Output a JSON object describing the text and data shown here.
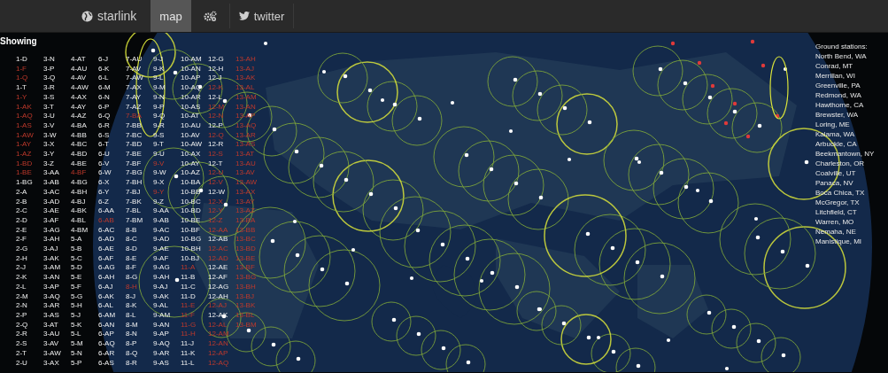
{
  "navbar": {
    "items": [
      {
        "kind": "brand",
        "label": "starlink",
        "selected": false
      },
      {
        "kind": "tab",
        "label": "map",
        "selected": true
      },
      {
        "kind": "settings",
        "selected": false
      },
      {
        "kind": "twitter",
        "label": "twitter",
        "selected": false
      }
    ]
  },
  "satellite_list": {
    "title": "Showing",
    "columns": [
      {
        "items": [
          {
            "label": "1-D",
            "active": true
          },
          {
            "label": "1-F",
            "active": false
          },
          {
            "label": "1-Q",
            "active": false
          },
          {
            "label": "1-T",
            "active": true
          },
          {
            "label": "1-Y",
            "active": false
          },
          {
            "label": "1-AK",
            "active": false
          },
          {
            "label": "1-AQ",
            "active": false
          },
          {
            "label": "1-AS",
            "active": false
          },
          {
            "label": "1-AW",
            "active": false
          },
          {
            "label": "1-AY",
            "active": false
          },
          {
            "label": "1-AZ",
            "active": false
          },
          {
            "label": "1-BD",
            "active": false
          },
          {
            "label": "1-BE",
            "active": false
          },
          {
            "label": "1-BG",
            "active": true
          },
          {
            "label": "2-A",
            "active": true
          },
          {
            "label": "2-B",
            "active": true
          },
          {
            "label": "2-C",
            "active": true
          },
          {
            "label": "2-D",
            "active": true
          },
          {
            "label": "2-E",
            "active": true
          },
          {
            "label": "2-F",
            "active": true
          },
          {
            "label": "2-G",
            "active": true
          },
          {
            "label": "2-H",
            "active": true
          },
          {
            "label": "2-J",
            "active": true
          },
          {
            "label": "2-K",
            "active": true
          },
          {
            "label": "2-L",
            "active": true
          },
          {
            "label": "2-M",
            "active": true
          },
          {
            "label": "2-N",
            "active": true
          },
          {
            "label": "2-P",
            "active": true
          },
          {
            "label": "2-Q",
            "active": true
          },
          {
            "label": "2-R",
            "active": true
          },
          {
            "label": "2-S",
            "active": true
          },
          {
            "label": "2-T",
            "active": true
          },
          {
            "label": "2-U",
            "active": true
          }
        ]
      },
      {
        "items": [
          {
            "label": "3-N",
            "active": true
          },
          {
            "label": "3-P",
            "active": true
          },
          {
            "label": "3-Q",
            "active": true
          },
          {
            "label": "3-R",
            "active": true
          },
          {
            "label": "3-S",
            "active": true
          },
          {
            "label": "3-T",
            "active": true
          },
          {
            "label": "3-U",
            "active": true
          },
          {
            "label": "3-V",
            "active": true
          },
          {
            "label": "3-W",
            "active": true
          },
          {
            "label": "3-X",
            "active": true
          },
          {
            "label": "3-Y",
            "active": true
          },
          {
            "label": "3-Z",
            "active": true
          },
          {
            "label": "3-AA",
            "active": true
          },
          {
            "label": "3-AB",
            "active": true
          },
          {
            "label": "3-AC",
            "active": true
          },
          {
            "label": "3-AD",
            "active": true
          },
          {
            "label": "3-AE",
            "active": true
          },
          {
            "label": "3-AF",
            "active": true
          },
          {
            "label": "3-AG",
            "active": true
          },
          {
            "label": "3-AH",
            "active": true
          },
          {
            "label": "3-AJ",
            "active": true
          },
          {
            "label": "3-AK",
            "active": true
          },
          {
            "label": "3-AM",
            "active": true
          },
          {
            "label": "3-AN",
            "active": true
          },
          {
            "label": "3-AP",
            "active": true
          },
          {
            "label": "3-AQ",
            "active": true
          },
          {
            "label": "3-AR",
            "active": true
          },
          {
            "label": "3-AS",
            "active": true
          },
          {
            "label": "3-AT",
            "active": true
          },
          {
            "label": "3-AU",
            "active": true
          },
          {
            "label": "3-AV",
            "active": true
          },
          {
            "label": "3-AW",
            "active": true
          },
          {
            "label": "3-AX",
            "active": true
          }
        ]
      },
      {
        "items": [
          {
            "label": "4-AT",
            "active": true
          },
          {
            "label": "4-AU",
            "active": true
          },
          {
            "label": "4-AV",
            "active": true
          },
          {
            "label": "4-AW",
            "active": true
          },
          {
            "label": "4-AX",
            "active": true
          },
          {
            "label": "4-AY",
            "active": true
          },
          {
            "label": "4-AZ",
            "active": true
          },
          {
            "label": "4-BA",
            "active": true
          },
          {
            "label": "4-BB",
            "active": true
          },
          {
            "label": "4-BC",
            "active": true
          },
          {
            "label": "4-BD",
            "active": true
          },
          {
            "label": "4-BE",
            "active": true
          },
          {
            "label": "4-BF",
            "active": false
          },
          {
            "label": "4-BG",
            "active": true
          },
          {
            "label": "4-BH",
            "active": true
          },
          {
            "label": "4-BJ",
            "active": true
          },
          {
            "label": "4-BK",
            "active": true
          },
          {
            "label": "4-BL",
            "active": true
          },
          {
            "label": "4-BM",
            "active": true
          },
          {
            "label": "5-A",
            "active": true
          },
          {
            "label": "5-B",
            "active": true
          },
          {
            "label": "5-C",
            "active": true
          },
          {
            "label": "5-D",
            "active": true
          },
          {
            "label": "5-E",
            "active": true
          },
          {
            "label": "5-F",
            "active": true
          },
          {
            "label": "5-G",
            "active": true
          },
          {
            "label": "5-H",
            "active": true
          },
          {
            "label": "5-J",
            "active": true
          },
          {
            "label": "5-K",
            "active": true
          },
          {
            "label": "5-L",
            "active": true
          },
          {
            "label": "5-M",
            "active": true
          },
          {
            "label": "5-N",
            "active": true
          },
          {
            "label": "5-P",
            "active": true
          }
        ]
      },
      {
        "items": [
          {
            "label": "6-J",
            "active": true
          },
          {
            "label": "6-K",
            "active": true
          },
          {
            "label": "6-L",
            "active": true
          },
          {
            "label": "6-M",
            "active": true
          },
          {
            "label": "6-N",
            "active": true
          },
          {
            "label": "6-P",
            "active": true
          },
          {
            "label": "6-Q",
            "active": true
          },
          {
            "label": "6-R",
            "active": true
          },
          {
            "label": "6-S",
            "active": true
          },
          {
            "label": "6-T",
            "active": true
          },
          {
            "label": "6-U",
            "active": true
          },
          {
            "label": "6-V",
            "active": true
          },
          {
            "label": "6-W",
            "active": true
          },
          {
            "label": "6-X",
            "active": true
          },
          {
            "label": "6-Y",
            "active": true
          },
          {
            "label": "6-Z",
            "active": true
          },
          {
            "label": "6-AA",
            "active": true
          },
          {
            "label": "6-AB",
            "active": false
          },
          {
            "label": "6-AC",
            "active": true
          },
          {
            "label": "6-AD",
            "active": true
          },
          {
            "label": "6-AE",
            "active": true
          },
          {
            "label": "6-AF",
            "active": true
          },
          {
            "label": "6-AG",
            "active": true
          },
          {
            "label": "6-AH",
            "active": true
          },
          {
            "label": "6-AJ",
            "active": true
          },
          {
            "label": "6-AK",
            "active": true
          },
          {
            "label": "6-AL",
            "active": true
          },
          {
            "label": "6-AM",
            "active": true
          },
          {
            "label": "6-AN",
            "active": true
          },
          {
            "label": "6-AP",
            "active": true
          },
          {
            "label": "6-AQ",
            "active": true
          },
          {
            "label": "6-AR",
            "active": true
          },
          {
            "label": "6-AS",
            "active": true
          }
        ]
      },
      {
        "items": [
          {
            "label": "7-AU",
            "active": true
          },
          {
            "label": "7-AV",
            "active": true
          },
          {
            "label": "7-AW",
            "active": true
          },
          {
            "label": "7-AX",
            "active": true
          },
          {
            "label": "7-AY",
            "active": true
          },
          {
            "label": "7-AZ",
            "active": true
          },
          {
            "label": "7-BA",
            "active": false
          },
          {
            "label": "7-BB",
            "active": true
          },
          {
            "label": "7-BC",
            "active": true
          },
          {
            "label": "7-BD",
            "active": true
          },
          {
            "label": "7-BE",
            "active": true
          },
          {
            "label": "7-BF",
            "active": true
          },
          {
            "label": "7-BG",
            "active": true
          },
          {
            "label": "7-BH",
            "active": true
          },
          {
            "label": "7-BJ",
            "active": true
          },
          {
            "label": "7-BK",
            "active": true
          },
          {
            "label": "7-BL",
            "active": true
          },
          {
            "label": "7-BM",
            "active": true
          },
          {
            "label": "8-B",
            "active": true
          },
          {
            "label": "8-C",
            "active": true
          },
          {
            "label": "8-D",
            "active": true
          },
          {
            "label": "8-E",
            "active": true
          },
          {
            "label": "8-F",
            "active": true
          },
          {
            "label": "8-G",
            "active": true
          },
          {
            "label": "8-H",
            "active": false
          },
          {
            "label": "8-J",
            "active": true
          },
          {
            "label": "8-K",
            "active": true
          },
          {
            "label": "8-L",
            "active": true
          },
          {
            "label": "8-M",
            "active": true
          },
          {
            "label": "8-N",
            "active": true
          },
          {
            "label": "8-P",
            "active": true
          },
          {
            "label": "8-Q",
            "active": true
          },
          {
            "label": "8-R",
            "active": true
          }
        ]
      },
      {
        "items": [
          {
            "label": "9-J",
            "active": true
          },
          {
            "label": "9-K",
            "active": true
          },
          {
            "label": "9-L",
            "active": true
          },
          {
            "label": "9-M",
            "active": true
          },
          {
            "label": "9-N",
            "active": true
          },
          {
            "label": "9-P",
            "active": true
          },
          {
            "label": "9-Q",
            "active": true
          },
          {
            "label": "9-R",
            "active": true
          },
          {
            "label": "9-S",
            "active": true
          },
          {
            "label": "9-T",
            "active": true
          },
          {
            "label": "9-U",
            "active": true
          },
          {
            "label": "9-V",
            "active": false
          },
          {
            "label": "9-W",
            "active": true
          },
          {
            "label": "9-X",
            "active": true
          },
          {
            "label": "9-Y",
            "active": false
          },
          {
            "label": "9-Z",
            "active": true
          },
          {
            "label": "9-AA",
            "active": true
          },
          {
            "label": "9-AB",
            "active": true
          },
          {
            "label": "9-AC",
            "active": true
          },
          {
            "label": "9-AD",
            "active": true
          },
          {
            "label": "9-AE",
            "active": true
          },
          {
            "label": "9-AF",
            "active": true
          },
          {
            "label": "9-AG",
            "active": true
          },
          {
            "label": "9-AH",
            "active": true
          },
          {
            "label": "9-AJ",
            "active": true
          },
          {
            "label": "9-AK",
            "active": true
          },
          {
            "label": "9-AL",
            "active": true
          },
          {
            "label": "9-AM",
            "active": true
          },
          {
            "label": "9-AN",
            "active": true
          },
          {
            "label": "9-AP",
            "active": true
          },
          {
            "label": "9-AQ",
            "active": true
          },
          {
            "label": "9-AR",
            "active": true
          },
          {
            "label": "9-AS",
            "active": true
          }
        ]
      },
      {
        "items": [
          {
            "label": "10-AM",
            "active": true
          },
          {
            "label": "10-AN",
            "active": true
          },
          {
            "label": "10-AP",
            "active": true
          },
          {
            "label": "10-AQ",
            "active": true
          },
          {
            "label": "10-AR",
            "active": true
          },
          {
            "label": "10-AS",
            "active": true
          },
          {
            "label": "10-AT",
            "active": true
          },
          {
            "label": "10-AU",
            "active": true
          },
          {
            "label": "10-AV",
            "active": true
          },
          {
            "label": "10-AW",
            "active": true
          },
          {
            "label": "10-AX",
            "active": true
          },
          {
            "label": "10-AY",
            "active": true
          },
          {
            "label": "10-AZ",
            "active": true
          },
          {
            "label": "10-BA",
            "active": true
          },
          {
            "label": "10-BB",
            "active": true
          },
          {
            "label": "10-BC",
            "active": true
          },
          {
            "label": "10-BD",
            "active": true
          },
          {
            "label": "10-BE",
            "active": true
          },
          {
            "label": "10-BF",
            "active": true
          },
          {
            "label": "10-BG",
            "active": true
          },
          {
            "label": "10-BH",
            "active": true
          },
          {
            "label": "10-BJ",
            "active": true
          },
          {
            "label": "11-A",
            "active": false
          },
          {
            "label": "11-B",
            "active": true
          },
          {
            "label": "11-C",
            "active": true
          },
          {
            "label": "11-D",
            "active": true
          },
          {
            "label": "11-E",
            "active": false
          },
          {
            "label": "11-F",
            "active": false
          },
          {
            "label": "11-G",
            "active": false
          },
          {
            "label": "11-H",
            "active": false
          },
          {
            "label": "11-J",
            "active": true
          },
          {
            "label": "11-K",
            "active": true
          },
          {
            "label": "11-L",
            "active": true
          }
        ]
      },
      {
        "items": [
          {
            "label": "12-G",
            "active": true
          },
          {
            "label": "12-H",
            "active": true
          },
          {
            "label": "12-J",
            "active": true
          },
          {
            "label": "12-K",
            "active": false
          },
          {
            "label": "12-L",
            "active": true
          },
          {
            "label": "12-M",
            "active": false
          },
          {
            "label": "12-N",
            "active": false
          },
          {
            "label": "12-P",
            "active": true
          },
          {
            "label": "12-Q",
            "active": false
          },
          {
            "label": "12-R",
            "active": true
          },
          {
            "label": "12-S",
            "active": false
          },
          {
            "label": "12-T",
            "active": true
          },
          {
            "label": "12-U",
            "active": false
          },
          {
            "label": "12-V",
            "active": false
          },
          {
            "label": "12-W",
            "active": true
          },
          {
            "label": "12-X",
            "active": false
          },
          {
            "label": "12-Y",
            "active": false
          },
          {
            "label": "12-Z",
            "active": false
          },
          {
            "label": "12-AA",
            "active": false
          },
          {
            "label": "12-AB",
            "active": true
          },
          {
            "label": "12-AC",
            "active": false
          },
          {
            "label": "12-AD",
            "active": false
          },
          {
            "label": "12-AE",
            "active": true
          },
          {
            "label": "12-AF",
            "active": true
          },
          {
            "label": "12-AG",
            "active": true
          },
          {
            "label": "12-AH",
            "active": true
          },
          {
            "label": "12-AJ",
            "active": false
          },
          {
            "label": "12-AK",
            "active": true
          },
          {
            "label": "12-AL",
            "active": false
          },
          {
            "label": "12-AM",
            "active": false
          },
          {
            "label": "12-AN",
            "active": false
          },
          {
            "label": "12-AP",
            "active": false
          },
          {
            "label": "12-AQ",
            "active": false
          }
        ]
      },
      {
        "items": [
          {
            "label": "13-AH",
            "active": false
          },
          {
            "label": "13-AJ",
            "active": false
          },
          {
            "label": "13-AK",
            "active": false
          },
          {
            "label": "13-AL",
            "active": false
          },
          {
            "label": "13-AM",
            "active": false
          },
          {
            "label": "13-AN",
            "active": false
          },
          {
            "label": "13-AP",
            "active": false
          },
          {
            "label": "13-AQ",
            "active": false
          },
          {
            "label": "13-AR",
            "active": false
          },
          {
            "label": "13-AS",
            "active": false
          },
          {
            "label": "13-AT",
            "active": false
          },
          {
            "label": "13-AU",
            "active": false
          },
          {
            "label": "13-AV",
            "active": false
          },
          {
            "label": "13-AW",
            "active": false
          },
          {
            "label": "13-AX",
            "active": false
          },
          {
            "label": "13-AY",
            "active": false
          },
          {
            "label": "13-AZ",
            "active": false
          },
          {
            "label": "13-BA",
            "active": false
          },
          {
            "label": "13-BB",
            "active": false
          },
          {
            "label": "13-BC",
            "active": false
          },
          {
            "label": "13-BD",
            "active": false
          },
          {
            "label": "13-BE",
            "active": false
          },
          {
            "label": "13-BF",
            "active": false
          },
          {
            "label": "13-BG",
            "active": false
          },
          {
            "label": "13-BH",
            "active": false
          },
          {
            "label": "13-BJ",
            "active": false
          },
          {
            "label": "13-BK",
            "active": false
          },
          {
            "label": "13-BL",
            "active": false
          },
          {
            "label": "13-BM",
            "active": false
          }
        ]
      }
    ]
  },
  "ground_stations": {
    "title": "Ground stations:",
    "items": [
      "North Bend, WA",
      "Conrad, MT",
      "Merrillan, WI",
      "Greenville, PA",
      "Redmond, WA",
      "Hawthorne, CA",
      "Brewster, WA",
      "Loring, ME",
      "Kalama, WA",
      "Arbuckle, CA",
      "Beekmantown, NY",
      "Charleston, OR",
      "Coalville, UT",
      "Panaca, NV",
      "Boca Chica, TX",
      "McGregor, TX",
      "Litchfield, CT",
      "Warren, MO",
      "Nemaha, NE",
      "Manistique, MI"
    ]
  }
}
